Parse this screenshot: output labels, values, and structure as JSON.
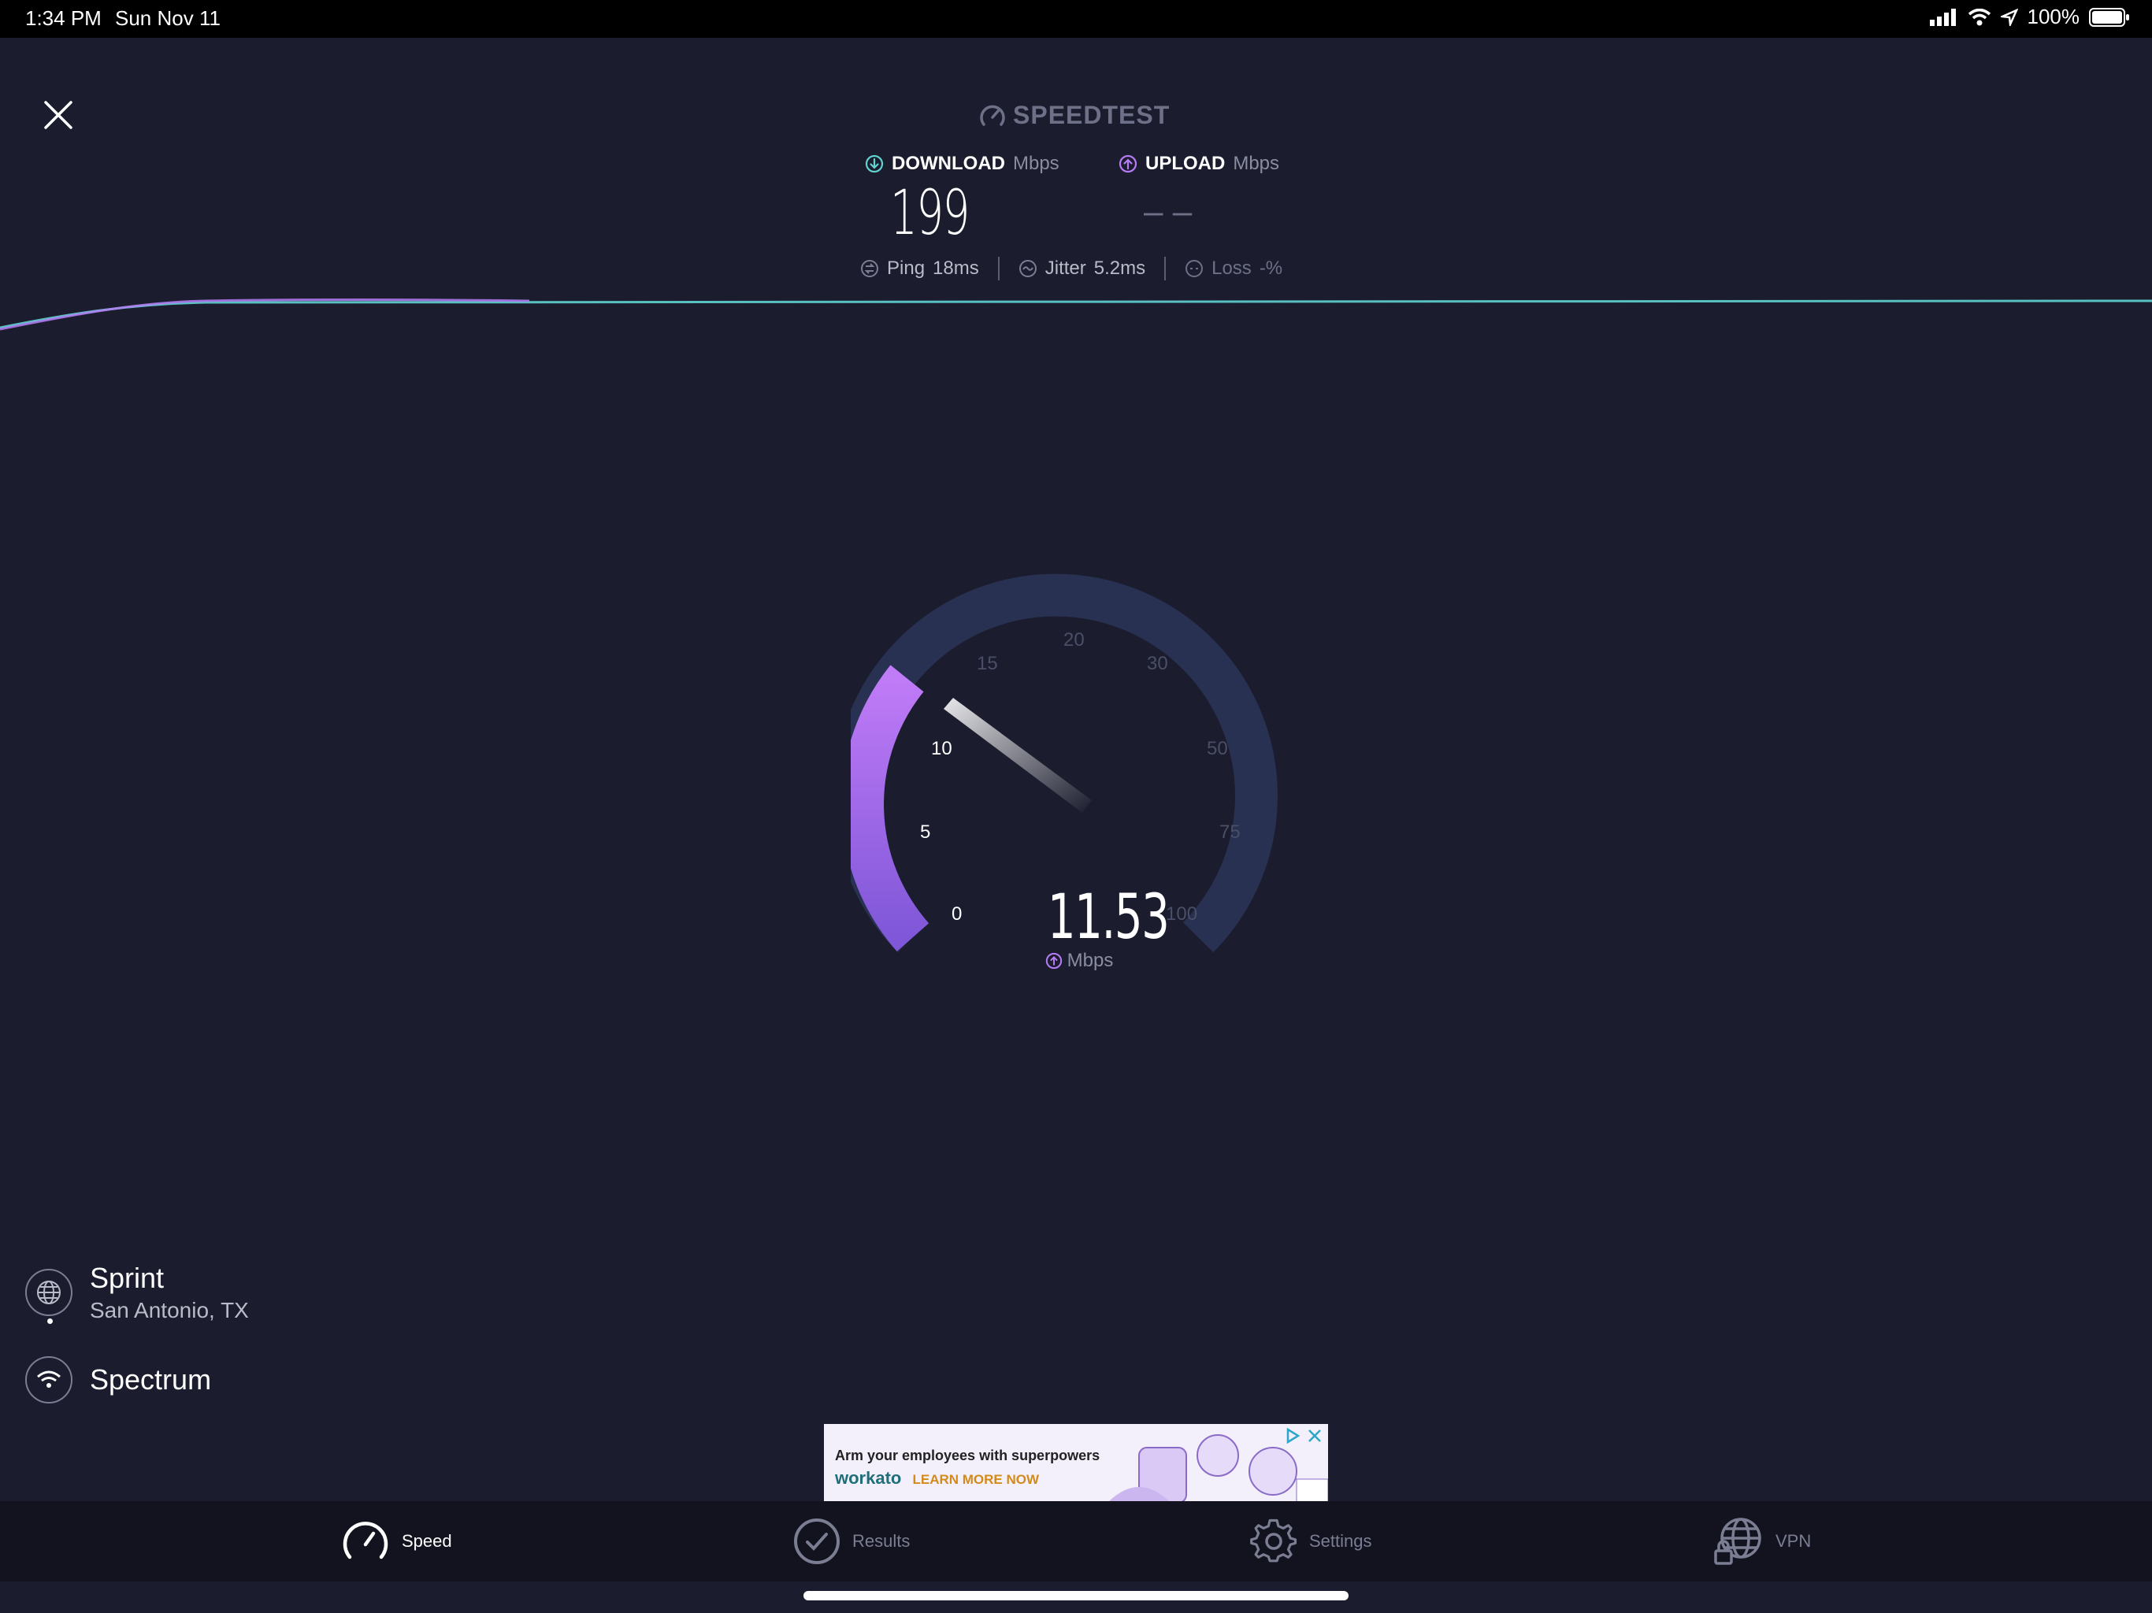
{
  "status_bar": {
    "time": "1:34 PM",
    "date": "Sun Nov 11",
    "battery": "100%"
  },
  "header": {
    "brand": "SPEEDTEST"
  },
  "download": {
    "label": "DOWNLOAD",
    "unit": "Mbps",
    "value": "199"
  },
  "upload": {
    "label": "UPLOAD",
    "unit": "Mbps",
    "value": "– –"
  },
  "stats": {
    "ping_label": "Ping",
    "ping_value": "18ms",
    "jitter_label": "Jitter",
    "jitter_value": "5.2ms",
    "loss_label": "Loss",
    "loss_value": "-%"
  },
  "gauge": {
    "ticks": [
      "0",
      "5",
      "10",
      "15",
      "20",
      "30",
      "50",
      "75",
      "100"
    ],
    "current_value": "11.53",
    "unit": "Mbps",
    "active_color": "#b57cf6",
    "track_color": "#283151"
  },
  "server": {
    "name": "Sprint",
    "location": "San Antonio, TX"
  },
  "connection": {
    "name": "Spectrum"
  },
  "ad": {
    "headline": "Arm your employees with superpowers",
    "brand": "workato",
    "cta": "LEARN MORE NOW"
  },
  "tabs": [
    {
      "label": "Speed",
      "icon": "speedometer-icon"
    },
    {
      "label": "Results",
      "icon": "checkmark-circle-icon"
    },
    {
      "label": "Settings",
      "icon": "gear-icon"
    },
    {
      "label": "VPN",
      "icon": "globe-lock-icon"
    }
  ],
  "colors": {
    "background": "#1b1d2e",
    "download_accent": "#5fd3d0",
    "upload_accent": "#b57cf6"
  }
}
